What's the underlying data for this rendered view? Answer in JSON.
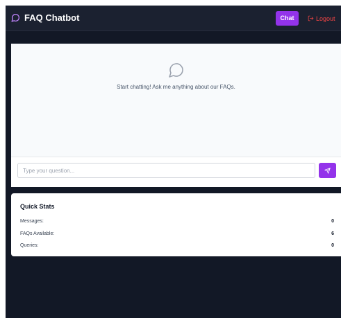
{
  "header": {
    "brand_icon": "chat-bubble-icon",
    "brand_title": "FAQ Chatbot",
    "chat_label": "Chat",
    "logout_icon": "logout-icon",
    "logout_label": "Logout"
  },
  "chat": {
    "empty_icon": "chat-bubble-icon",
    "empty_text": "Start chatting! Ask me anything about our FAQs.",
    "input_value": "",
    "input_placeholder": "Type your question...",
    "send_icon": "send-icon"
  },
  "stats": {
    "title": "Quick Stats",
    "rows": [
      {
        "label": "Messages:",
        "value": "0"
      },
      {
        "label": "FAQs Available:",
        "value": "6"
      },
      {
        "label": "Queries:",
        "value": "0"
      }
    ]
  },
  "colors": {
    "accent": "#9333ea",
    "logout": "#ef4444",
    "background": "#121826",
    "navbar": "#1b2130"
  }
}
